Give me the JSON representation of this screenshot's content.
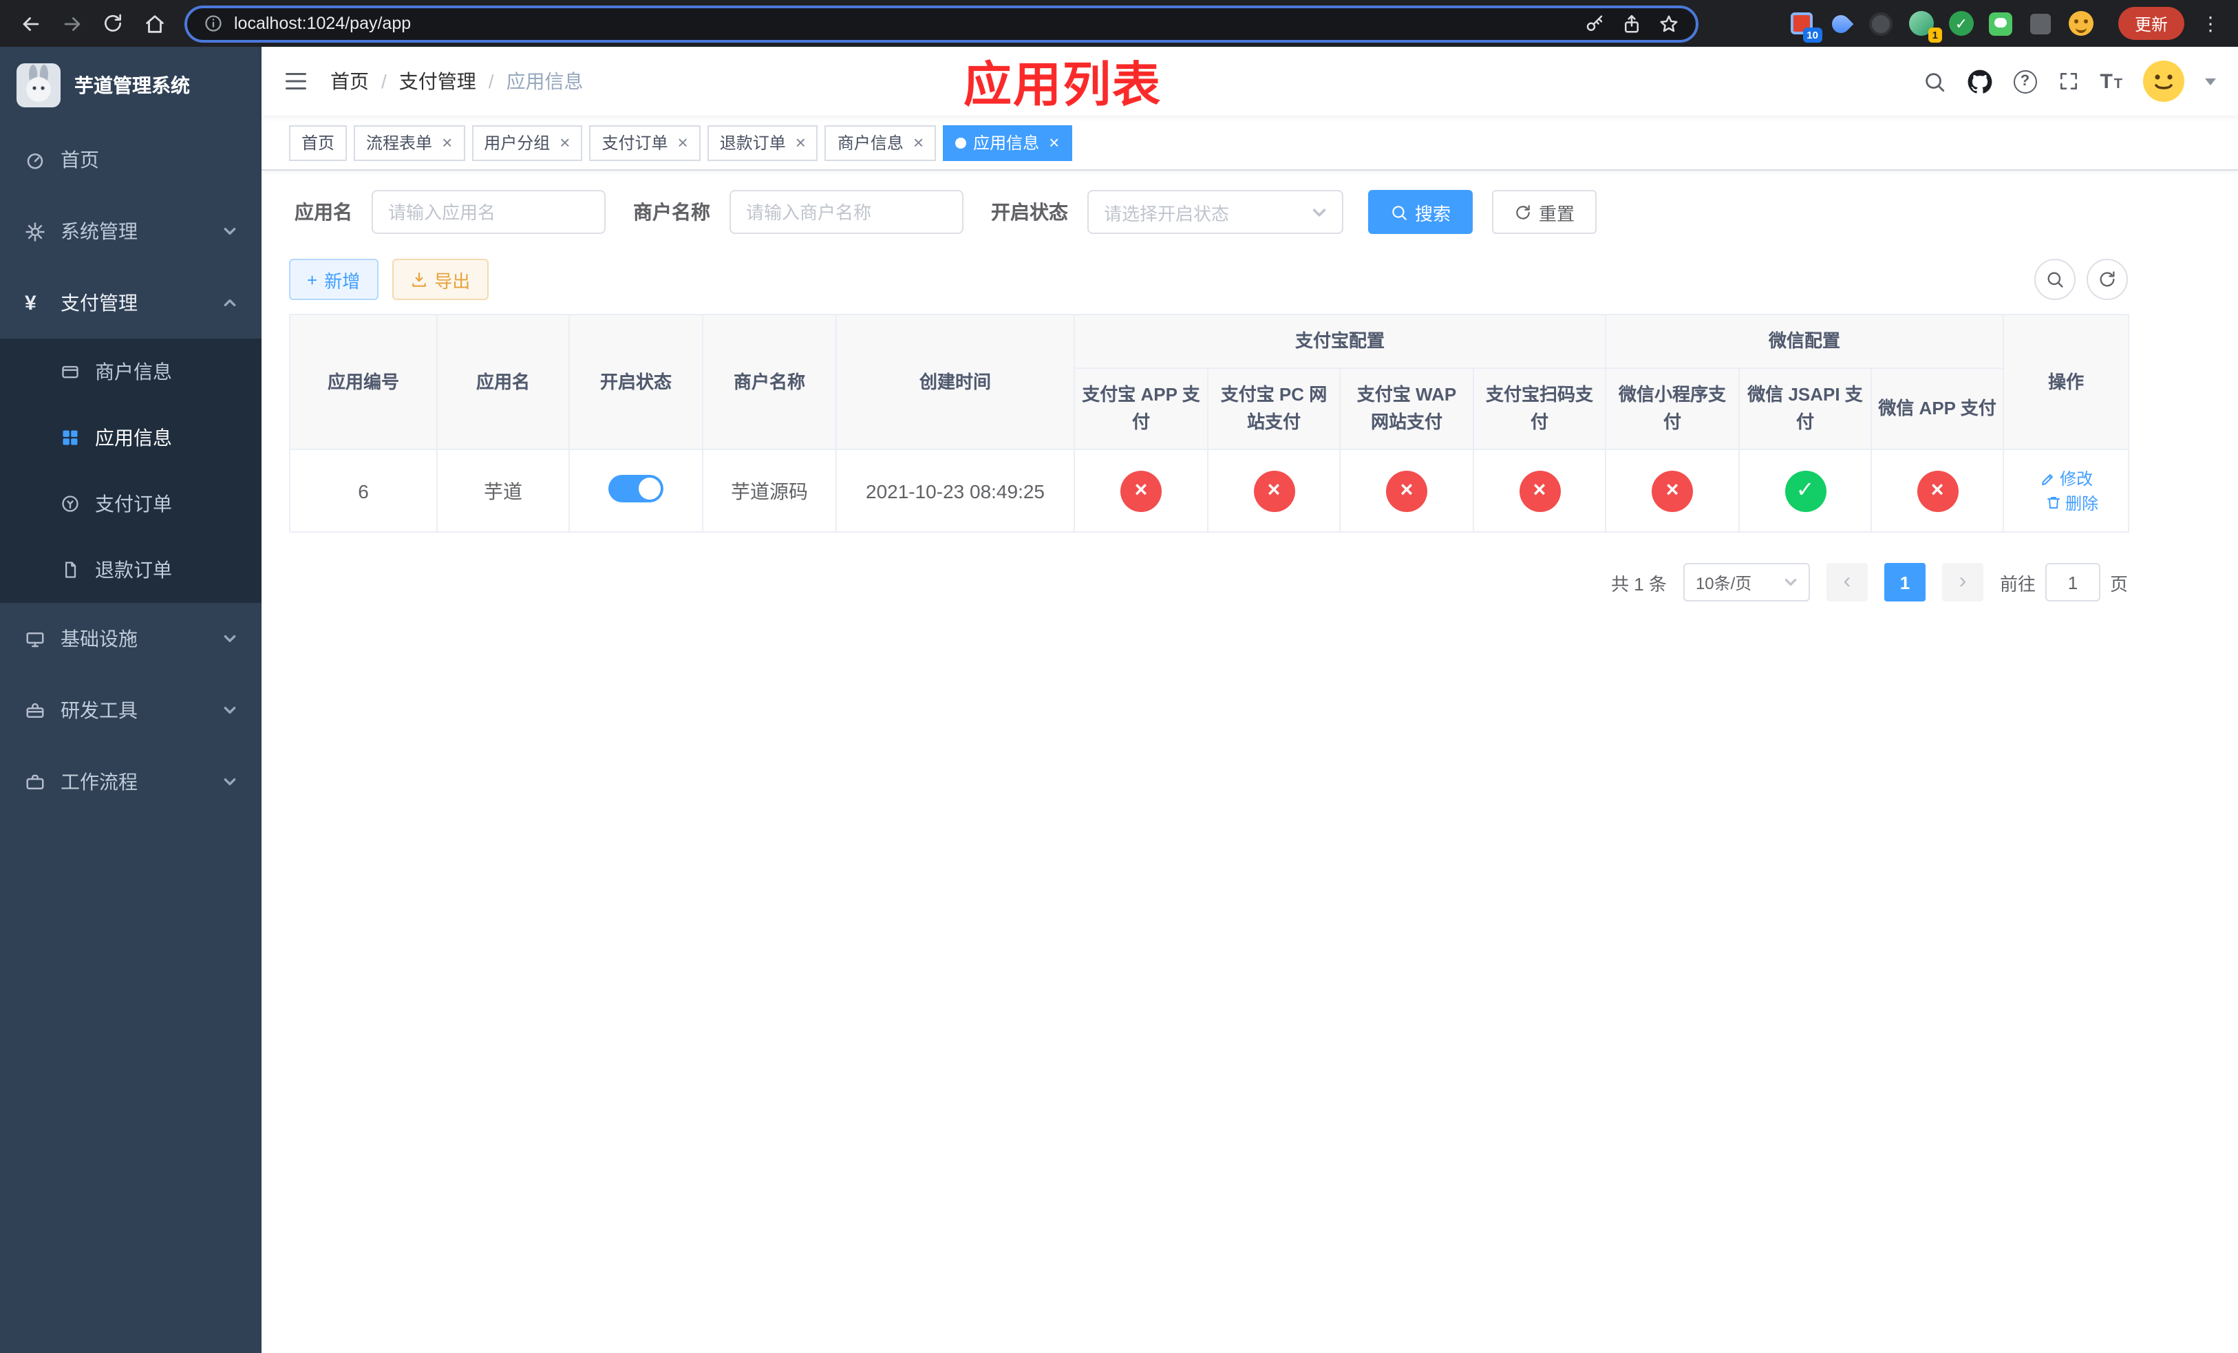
{
  "browser": {
    "url": "localhost:1024/pay/app",
    "update_label": "更新",
    "ext_badge_blue": "10",
    "ext_badge_yellow": "1"
  },
  "glyphs": {
    "yen": "¥",
    "close": "×",
    "check": "✓",
    "cross": "×",
    "question": "?",
    "font_big": "T",
    "font_small": "T",
    "plus": "+",
    "prev": "‹",
    "next": "›",
    "dots": "⋮"
  },
  "sidebar": {
    "title": "芋道管理系统",
    "items": {
      "home": "首页",
      "system": "系统管理",
      "payment": "支付管理",
      "merchant_info": "商户信息",
      "app_info": "应用信息",
      "pay_order": "支付订单",
      "refund_order": "退款订单",
      "infrastructure": "基础设施",
      "dev_tools": "研发工具",
      "workflow": "工作流程"
    }
  },
  "header": {
    "breadcrumb": [
      "首页",
      "支付管理",
      "应用信息"
    ],
    "annotation": "应用列表"
  },
  "tabs": [
    {
      "label": "首页",
      "active": false,
      "closable": false
    },
    {
      "label": "流程表单",
      "active": false,
      "closable": true
    },
    {
      "label": "用户分组",
      "active": false,
      "closable": true
    },
    {
      "label": "支付订单",
      "active": false,
      "closable": true
    },
    {
      "label": "退款订单",
      "active": false,
      "closable": true
    },
    {
      "label": "商户信息",
      "active": false,
      "closable": true
    },
    {
      "label": "应用信息",
      "active": true,
      "closable": true
    }
  ],
  "filters": {
    "app_name_label": "应用名",
    "app_name_placeholder": "请输入应用名",
    "merchant_label": "商户名称",
    "merchant_placeholder": "请输入商户名称",
    "status_label": "开启状态",
    "status_placeholder": "请选择开启状态",
    "search_button": "搜索",
    "reset_button": "重置"
  },
  "toolbar": {
    "add_button": "新增",
    "export_button": "导出"
  },
  "table": {
    "groups": {
      "alipay": "支付宝配置",
      "wechat": "微信配置"
    },
    "headers": {
      "app_id": "应用编号",
      "app_name": "应用名",
      "status": "开启状态",
      "merchant_name": "商户名称",
      "create_time": "创建时间",
      "alipay_app": "支付宝 APP 支付",
      "alipay_pc": "支付宝 PC 网站支付",
      "alipay_wap": "支付宝 WAP 网站支付",
      "alipay_qr": "支付宝扫码支付",
      "wechat_mini": "微信小程序支付",
      "wechat_jsapi": "微信 JSAPI 支付",
      "wechat_app": "微信 APP 支付",
      "actions": "操作"
    },
    "row": {
      "id": "6",
      "name": "芋道",
      "enabled": true,
      "merchant": "芋道源码",
      "created": "2021-10-23 08:49:25",
      "statuses": {
        "alipay_app": false,
        "alipay_pc": false,
        "alipay_wap": false,
        "alipay_qr": false,
        "wechat_mini": false,
        "wechat_jsapi": true,
        "wechat_app": false
      },
      "edit_label": "修改",
      "delete_label": "删除"
    }
  },
  "pagination": {
    "total": "共 1 条",
    "page_size": "10条/页",
    "page": "1",
    "goto_label": "前往",
    "goto_value": "1",
    "page_unit": "页"
  },
  "colors": {
    "primary": "#409EFF",
    "success": "#13CE66",
    "danger": "#F34D4D",
    "warning": "#E6A23C",
    "sidebar_bg": "#304156",
    "submenu_bg": "#1F2D3D",
    "annotation_red": "#FB2A2A",
    "browser_bar": "#202124"
  }
}
